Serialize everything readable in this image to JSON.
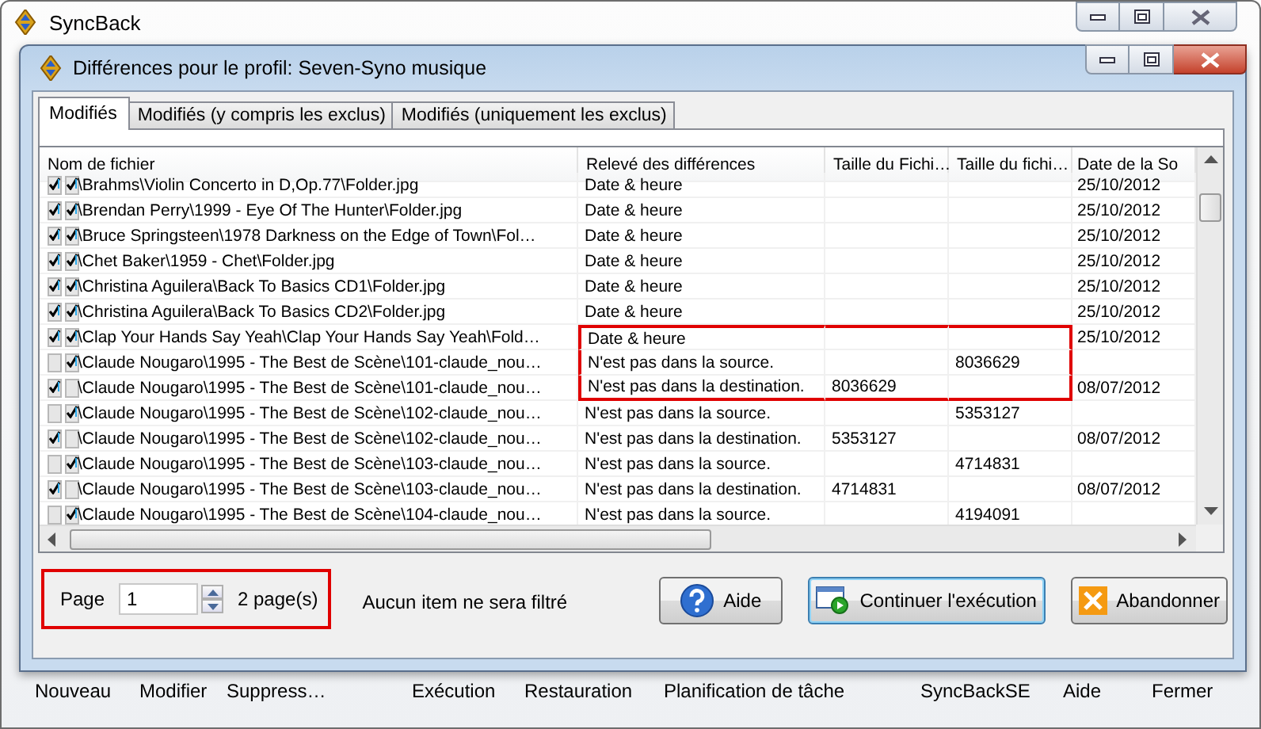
{
  "app_window": {
    "title": "SyncBack"
  },
  "dialog": {
    "title": "Différences pour le profil: Seven-Syno musique",
    "tabs": [
      {
        "label": "Modifiés",
        "selected": true
      },
      {
        "label": "Modifiés (y compris les exclus)",
        "selected": false
      },
      {
        "label": "Modifiés (uniquement les exclus)",
        "selected": false
      }
    ],
    "table": {
      "columns": [
        "Nom de fichier",
        "Relevé des différences",
        "Taille du Fichi…",
        "Taille du fichi…",
        "Date de la So"
      ],
      "rows": [
        {
          "source_checked": true,
          "destination_checked": true,
          "highlighted": false,
          "name": "\\Brahms\\Violin Concerto in D,Op.77\\Folder.jpg",
          "difference": "Date & heure",
          "date": "25/10/2012"
        },
        {
          "source_checked": true,
          "destination_checked": true,
          "highlighted": false,
          "name": "\\Brendan Perry\\1999 - Eye Of The Hunter\\Folder.jpg",
          "difference": "Date & heure",
          "date": "25/10/2012"
        },
        {
          "source_checked": true,
          "destination_checked": true,
          "highlighted": false,
          "name": "\\Bruce Springsteen\\1978 Darkness on the Edge of Town\\Fol…",
          "difference": "Date & heure",
          "date": "25/10/2012"
        },
        {
          "source_checked": true,
          "destination_checked": true,
          "highlighted": false,
          "name": "\\Chet Baker\\1959 - Chet\\Folder.jpg",
          "difference": "Date & heure",
          "date": "25/10/2012"
        },
        {
          "source_checked": true,
          "destination_checked": true,
          "highlighted": false,
          "name": "\\Christina Aguilera\\Back To Basics CD1\\Folder.jpg",
          "difference": "Date & heure",
          "date": "25/10/2012"
        },
        {
          "source_checked": true,
          "destination_checked": true,
          "highlighted": false,
          "name": "\\Christina Aguilera\\Back To Basics CD2\\Folder.jpg",
          "difference": "Date & heure",
          "date": "25/10/2012"
        },
        {
          "source_checked": true,
          "destination_checked": true,
          "highlighted": true,
          "name": "\\Clap Your Hands Say Yeah\\Clap Your Hands Say Yeah\\Fold…",
          "difference": "Date & heure",
          "date": "25/10/2012"
        },
        {
          "source_checked": false,
          "destination_checked": true,
          "highlighted": true,
          "name": "\\Claude Nougaro\\1995 - The Best de Scène\\101-claude_nou…",
          "difference": "N'est pas dans la source.",
          "destination_size": "8036629"
        },
        {
          "source_checked": true,
          "destination_checked": false,
          "highlighted": true,
          "name": "\\Claude Nougaro\\1995 - The Best de Scène\\101-claude_nou…",
          "difference": "N'est pas dans la destination.",
          "source_size": "8036629",
          "date": "08/07/2012"
        },
        {
          "source_checked": false,
          "destination_checked": true,
          "highlighted": false,
          "name": "\\Claude Nougaro\\1995 - The Best de Scène\\102-claude_nou…",
          "difference": "N'est pas dans la source.",
          "destination_size": "5353127"
        },
        {
          "source_checked": true,
          "destination_checked": false,
          "highlighted": false,
          "name": "\\Claude Nougaro\\1995 - The Best de Scène\\102-claude_nou…",
          "difference": "N'est pas dans la destination.",
          "source_size": "5353127",
          "date": "08/07/2012"
        },
        {
          "source_checked": false,
          "destination_checked": true,
          "highlighted": false,
          "name": "\\Claude Nougaro\\1995 - The Best de Scène\\103-claude_nou…",
          "difference": "N'est pas dans la source.",
          "destination_size": "4714831"
        },
        {
          "source_checked": true,
          "destination_checked": false,
          "highlighted": false,
          "name": "\\Claude Nougaro\\1995 - The Best de Scène\\103-claude_nou…",
          "difference": "N'est pas dans la destination.",
          "source_size": "4714831",
          "date": "08/07/2012"
        },
        {
          "source_checked": false,
          "destination_checked": true,
          "highlighted": false,
          "name": "\\Claude Nougaro\\1995 - The Best de Scène\\104-claude_nou…",
          "difference": "N'est pas dans la source.",
          "destination_size": "4194091"
        }
      ]
    },
    "pager": {
      "label": "Page",
      "value": "1",
      "total": "2 page(s)",
      "highlighted": true
    },
    "filter_note": "Aucun item ne sera filtré",
    "buttons": [
      {
        "label": "Aide",
        "kind": "help",
        "default": false
      },
      {
        "label": "Continuer l'exécution",
        "kind": "run",
        "default": true
      },
      {
        "label": "Abandonner",
        "kind": "abort",
        "default": false
      }
    ]
  },
  "toolbar": [
    "Nouveau",
    "Modifier",
    "Suppress…",
    "Exécution",
    "Restauration",
    "Planification de tâche",
    "SyncBackSE",
    "Aide",
    "Fermer"
  ]
}
